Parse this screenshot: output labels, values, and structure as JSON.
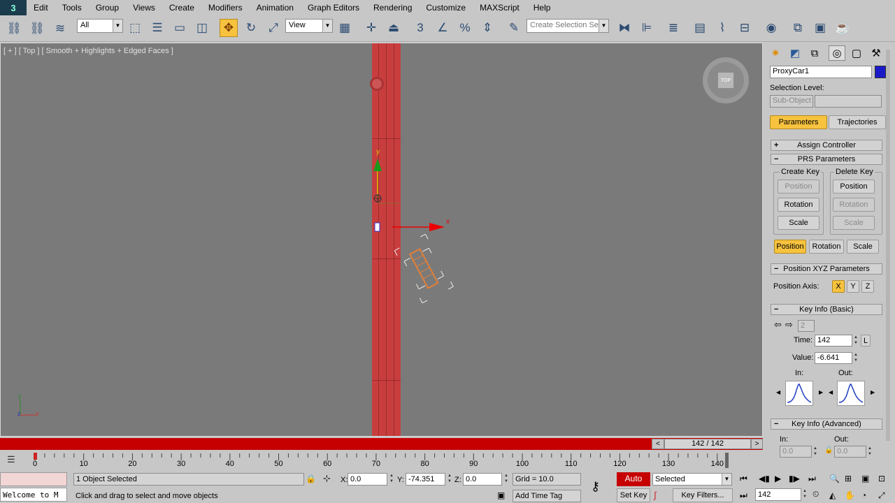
{
  "menubar": {
    "logo": "3",
    "items": [
      "Edit",
      "Tools",
      "Group",
      "Views",
      "Create",
      "Modifiers",
      "Animation",
      "Graph Editors",
      "Rendering",
      "Customize",
      "MAXScript",
      "Help"
    ]
  },
  "toolbar": {
    "filter_select": "All",
    "coord_select": "View",
    "selection_set_placeholder": "Create Selection Se"
  },
  "viewport": {
    "label": "[ + ] [ Top ] [ Smooth + Highlights + Edged Faces ]",
    "viewcube_label": "TOP",
    "gizmo_x": "x",
    "gizmo_y": "y",
    "axis_y": "y",
    "axis_x": "x",
    "axis_z": "z"
  },
  "command_panel": {
    "object_name": "ProxyCar1",
    "object_color": "#1a1ac8",
    "selection_level_label": "Selection Level:",
    "sub_object": "Sub-Object",
    "tabs": {
      "parameters": "Parameters",
      "trajectories": "Trajectories"
    },
    "assign_controller": "Assign Controller",
    "prs_parameters": "PRS Parameters",
    "create_key": "Create Key",
    "delete_key": "Delete Key",
    "create_position": "Position",
    "create_rotation": "Rotation",
    "create_scale": "Scale",
    "delete_position": "Position",
    "delete_rotation": "Rotation",
    "delete_scale": "Scale",
    "mode_position": "Position",
    "mode_rotation": "Rotation",
    "mode_scale": "Scale",
    "position_xyz": "Position XYZ Parameters",
    "position_axis_label": "Position Axis:",
    "axis_x": "X",
    "axis_y": "Y",
    "axis_z": "Z",
    "key_info_basic": "Key Info (Basic)",
    "key_number": "2",
    "time_label": "Time:",
    "time_value": "142",
    "lock_label": "L",
    "value_label": "Value:",
    "value_value": "-6.641",
    "in_label": "In:",
    "out_label": "Out:",
    "key_info_advanced": "Key Info (Advanced)",
    "adv_in_label": "In:",
    "adv_out_label": "Out:",
    "adv_in_value": "0.0",
    "adv_out_value": "0.0"
  },
  "timeline": {
    "frame_display": "142 / 142",
    "prev": "<",
    "next": ">",
    "ticks": [
      "0",
      "10",
      "20",
      "30",
      "40",
      "50",
      "60",
      "70",
      "80",
      "90",
      "100",
      "110",
      "120",
      "130",
      "140"
    ]
  },
  "status": {
    "maxscript_listener": "Welcome to M",
    "selection_status": "1 Object Selected",
    "prompt": "Click and drag to select and move objects",
    "x_label": "X:",
    "x_value": "0.0",
    "y_label": "Y:",
    "y_value": "-74.351",
    "z_label": "Z:",
    "z_value": "0.0",
    "grid": "Grid = 10.0",
    "add_time_tag": "Add Time Tag",
    "auto_key": "Auto Key",
    "set_key": "Set Key",
    "selected_select": "Selected",
    "key_filters": "Key Filters...",
    "current_frame": "142"
  }
}
